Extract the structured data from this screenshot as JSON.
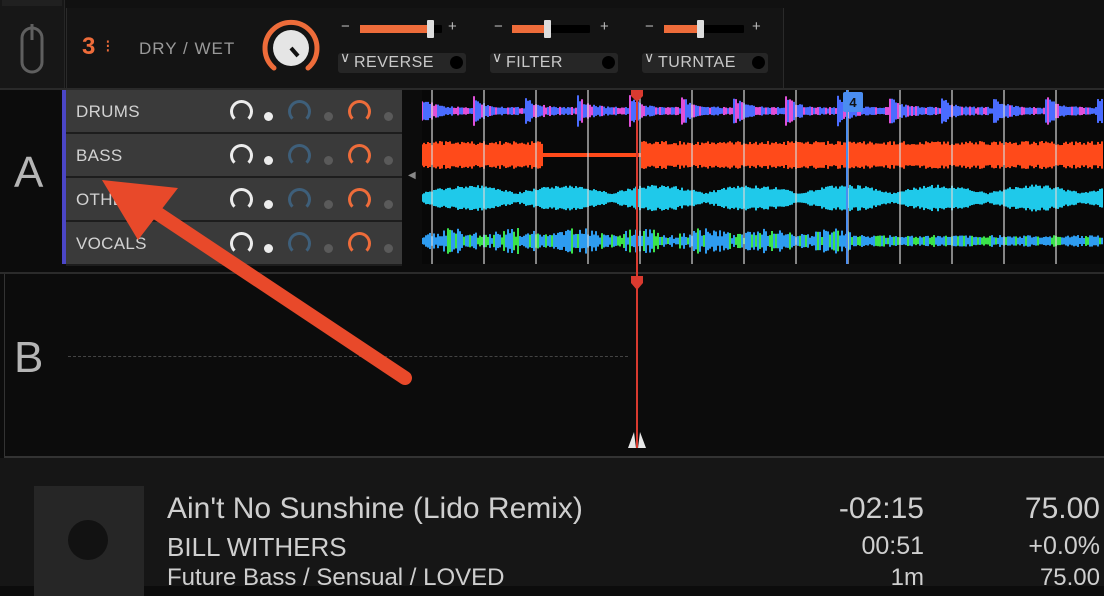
{
  "fx": {
    "unit_number": "3",
    "unit_dots_glyph": "⁝",
    "drywet_label": "DRY / WET",
    "minus_label": "−",
    "plus_label": "+",
    "effects": [
      {
        "name": "REVERSE",
        "level": 0.85
      },
      {
        "name": "FILTER",
        "level": 0.45
      },
      {
        "name": "TURNTAE",
        "level": 0.45
      }
    ],
    "chevron_glyph": "∨"
  },
  "deck_a": {
    "letter": "A",
    "stems": [
      {
        "name": "DRUMS"
      },
      {
        "name": "BASS"
      },
      {
        "name": "OTHER"
      },
      {
        "name": "VOCALS"
      }
    ],
    "collapse_glyph": "◀",
    "cue_badge": "4"
  },
  "deck_b": {
    "letter": "B"
  },
  "track": {
    "title": "Ain't No Sunshine (Lido Remix)",
    "artist": "BILL WITHERS",
    "tags": "Future Bass / Sensual / LOVED",
    "remaining": "-02:15",
    "elapsed": "00:51",
    "length": "1m",
    "bpm": "75.00",
    "pitch": "+0.0%",
    "bpm_secondary": "75.00"
  },
  "colors": {
    "accent": "#ee6c3a",
    "deck_stripe": "#4b46c6",
    "playhead": "#d93a2f",
    "annotation_arrow": "#e8492a",
    "wave_drums": "#4a6cff",
    "wave_drums_accent": "#e04fd8",
    "wave_bass": "#ff4a1a",
    "wave_other": "#1fc9ea",
    "wave_vocals": "#2e9cf0",
    "wave_vocals_accent": "#3be34a"
  }
}
